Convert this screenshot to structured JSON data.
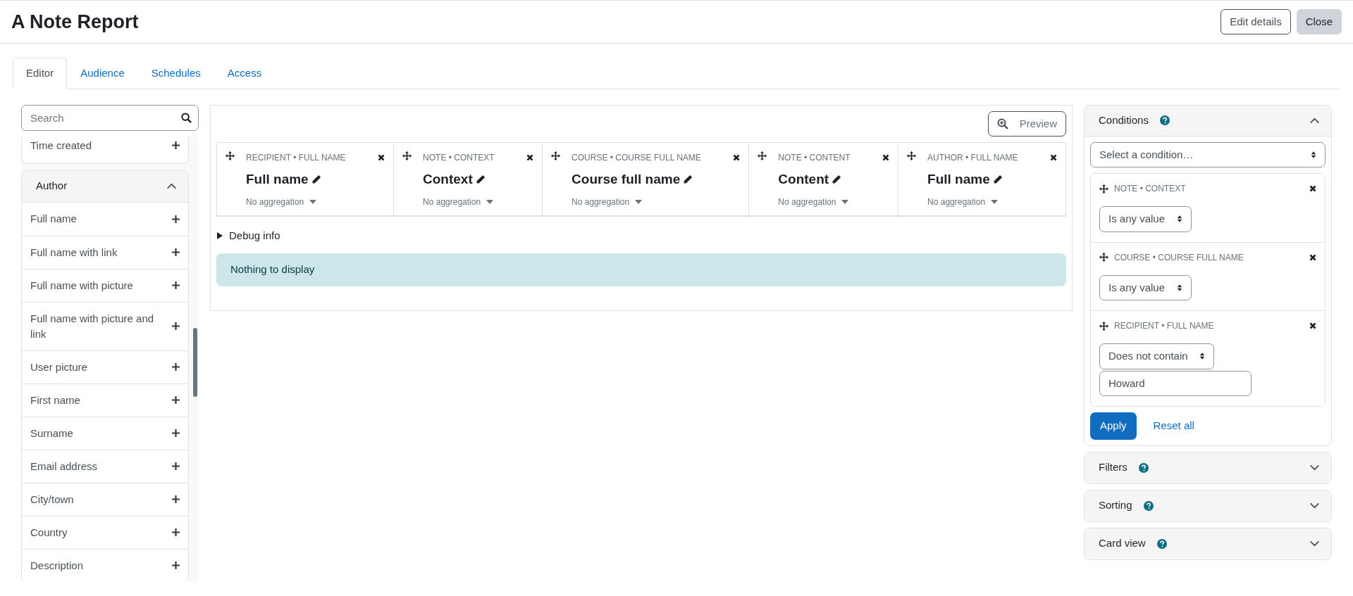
{
  "page_title": "A Note Report",
  "header_buttons": [
    {
      "label": "Edit details",
      "kind": "outline"
    },
    {
      "label": "Close",
      "kind": "secondary"
    }
  ],
  "tabs": [
    {
      "label": "Editor",
      "selected": true
    },
    {
      "label": "Audience",
      "selected": false
    },
    {
      "label": "Schedules",
      "selected": false
    },
    {
      "label": "Access",
      "selected": false
    }
  ],
  "sidebar": {
    "search": {
      "placeholder": "Search"
    },
    "cut_group_items": [
      "Time created"
    ],
    "groups": [
      {
        "title": "Author",
        "expanded": true,
        "items": [
          "Full name",
          "Full name with link",
          "Full name with picture",
          "Full name with picture and link",
          "User picture",
          "First name",
          "Surname",
          "Email address",
          "City/town",
          "Country",
          "Description"
        ]
      }
    ]
  },
  "preview_button": "Preview",
  "columns": [
    {
      "source": "RECIPIENT • FULL NAME",
      "title": "Full name",
      "aggregation": "No aggregation"
    },
    {
      "source": "NOTE • CONTEXT",
      "title": "Context",
      "aggregation": "No aggregation"
    },
    {
      "source": "COURSE • COURSE FULL NAME",
      "title": "Course full name",
      "aggregation": "No aggregation"
    },
    {
      "source": "NOTE • CONTENT",
      "title": "Content",
      "aggregation": "No aggregation"
    },
    {
      "source": "AUTHOR • FULL NAME",
      "title": "Full name",
      "aggregation": "No aggregation"
    }
  ],
  "debug": {
    "label": "Debug info",
    "expanded": false
  },
  "alert": "Nothing to display",
  "panels": [
    {
      "title": "Conditions",
      "expanded": true,
      "select": "Select a condition…",
      "conditions": [
        {
          "source": "NOTE • CONTEXT",
          "operator": "Is any value"
        },
        {
          "source": "COURSE • COURSE FULL NAME",
          "operator": "Is any value"
        },
        {
          "source": "RECIPIENT • FULL NAME",
          "operator": "Does not contain",
          "value": "Howard"
        }
      ],
      "apply": "Apply",
      "reset": "Reset all"
    },
    {
      "title": "Filters",
      "expanded": false
    },
    {
      "title": "Sorting",
      "expanded": false
    },
    {
      "title": "Card view",
      "expanded": false
    }
  ]
}
